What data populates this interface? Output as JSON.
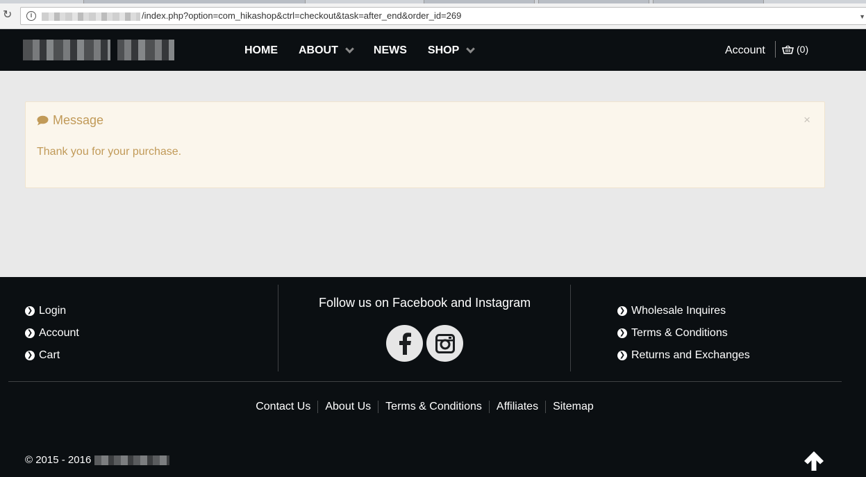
{
  "browser": {
    "url_path": "/index.php?option=com_hikashop&ctrl=checkout&task=after_end&order_id=269"
  },
  "header": {
    "nav": [
      {
        "label": "HOME",
        "has_dropdown": false
      },
      {
        "label": "ABOUT",
        "has_dropdown": true
      },
      {
        "label": "NEWS",
        "has_dropdown": false
      },
      {
        "label": "SHOP",
        "has_dropdown": true
      }
    ],
    "account_label": "Account",
    "cart_label": "(0)"
  },
  "message": {
    "title": "Message",
    "text": "Thank you for your purchase.",
    "close": "×"
  },
  "footer": {
    "left_links": [
      "Login",
      "Account",
      "Cart"
    ],
    "follow_text": "Follow us on Facebook and Instagram",
    "social": [
      "facebook-icon",
      "instagram-icon"
    ],
    "right_links": [
      "Wholesale Inquires",
      "Terms & Conditions",
      "Returns and Exchanges"
    ],
    "bottom_links": [
      "Contact Us",
      "About Us",
      "Terms & Conditions",
      "Affiliates",
      "Sitemap"
    ],
    "copyright": "© 2015 - 2016"
  },
  "colors": {
    "header_bg": "#0b0f12",
    "page_bg": "#e9e9e9",
    "message_bg": "#fbf6ec",
    "message_text": "#c19a58"
  }
}
